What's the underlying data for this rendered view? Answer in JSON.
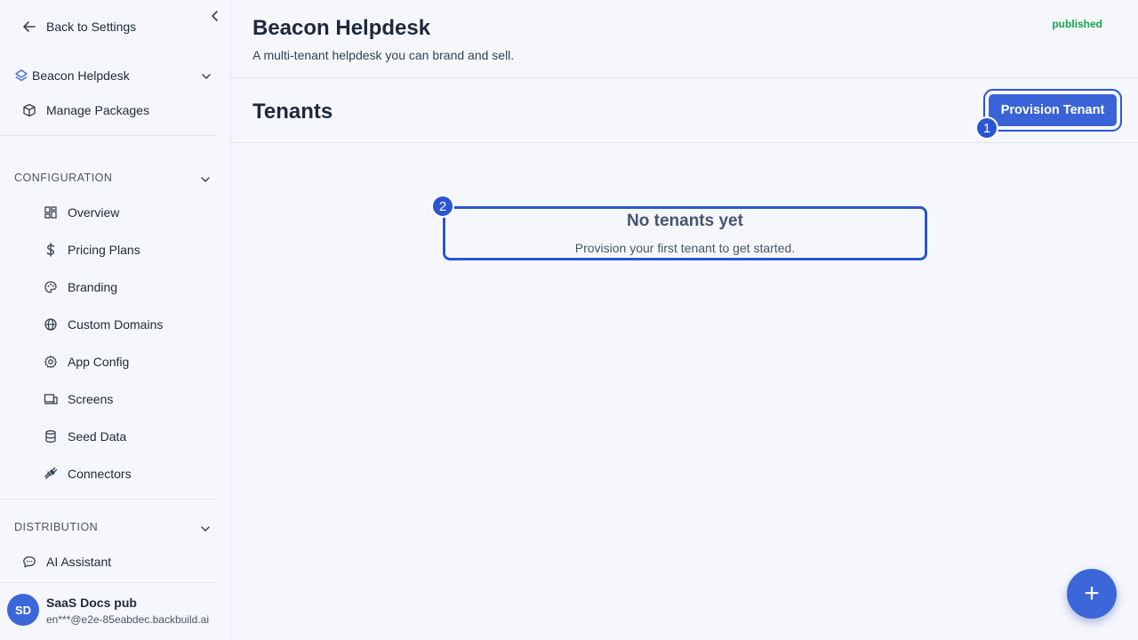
{
  "sidebar": {
    "back_label": "Back to Settings",
    "project_name": "Beacon Helpdesk",
    "manage_packages": "Manage Packages",
    "configuration_heading": "CONFIGURATION",
    "items": [
      {
        "label": "Overview",
        "icon": "dashboard-icon"
      },
      {
        "label": "Pricing Plans",
        "icon": "dollar-icon"
      },
      {
        "label": "Branding",
        "icon": "palette-icon"
      },
      {
        "label": "Custom Domains",
        "icon": "globe-icon"
      },
      {
        "label": "App Config",
        "icon": "gear-icon"
      },
      {
        "label": "Screens",
        "icon": "devices-icon"
      },
      {
        "label": "Seed Data",
        "icon": "database-icon"
      },
      {
        "label": "Connectors",
        "icon": "plug-icon"
      }
    ],
    "distribution_heading": "DISTRIBUTION",
    "ai_assistant": "AI Assistant",
    "user": {
      "initials": "SD",
      "name": "SaaS Docs pub",
      "email": "en***@e2e-85eabdec.backbuild.ai"
    }
  },
  "header": {
    "title": "Beacon Helpdesk",
    "description": "A multi-tenant helpdesk you can brand and sell.",
    "status": "published",
    "status_color": "#16a34a"
  },
  "tenants": {
    "title": "Tenants",
    "provision_button": "Provision Tenant",
    "empty_title": "No tenants yet",
    "empty_subtitle": "Provision your first tenant to get started."
  },
  "markers": [
    "1",
    "2"
  ],
  "fab_label": "+",
  "colors": {
    "accent": "#3b63d8",
    "highlight": "#2b55d3"
  }
}
